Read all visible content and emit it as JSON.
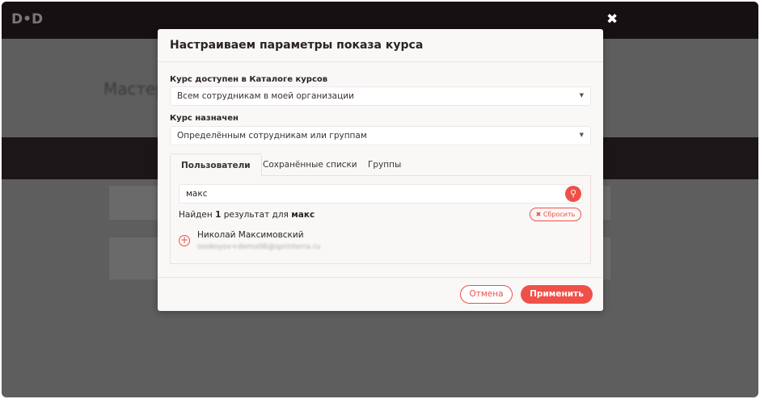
{
  "background": {
    "logo": "D•D",
    "page_title": "Мастер"
  },
  "modal": {
    "title": "Настраиваем параметры показа курса",
    "catalog_label": "Курс доступен в Каталоге курсов",
    "catalog_value": "Всем сотрудникам в моей организации",
    "assigned_label": "Курс назначен",
    "assigned_value": "Определённым сотрудникам или группам",
    "tabs": [
      {
        "label": "Пользователи",
        "active": true
      },
      {
        "label": "Сохранённые списки"
      },
      {
        "label": "Группы"
      }
    ],
    "search_value": "макс",
    "result": {
      "prefix": "Найден ",
      "count": "1",
      "middle": " результат для ",
      "query": "макс"
    },
    "reset_label": "✖ Сбросить",
    "users": [
      {
        "name": "Николай Максимовский",
        "email": "osokoyov+demo06@sprinterra.ru"
      }
    ],
    "cancel_label": "Отмена",
    "apply_label": "Применить"
  },
  "colors": {
    "accent": "#ef5048"
  }
}
